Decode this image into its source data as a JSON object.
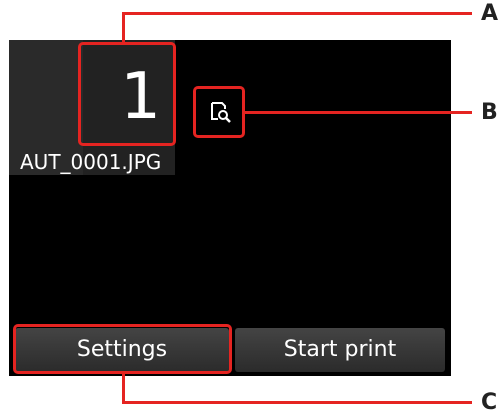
{
  "screen": {
    "copies_value": "1",
    "filename": "AUT_0001.JPG",
    "preview_icon": "magnify-preview-icon"
  },
  "buttons": {
    "settings": "Settings",
    "start_print": "Start print"
  },
  "callouts": {
    "a": "A",
    "b": "B",
    "c": "C"
  },
  "colors": {
    "callout_red": "#e52421",
    "screen_bg": "#000000",
    "button_bg": "#3a3a3a"
  }
}
